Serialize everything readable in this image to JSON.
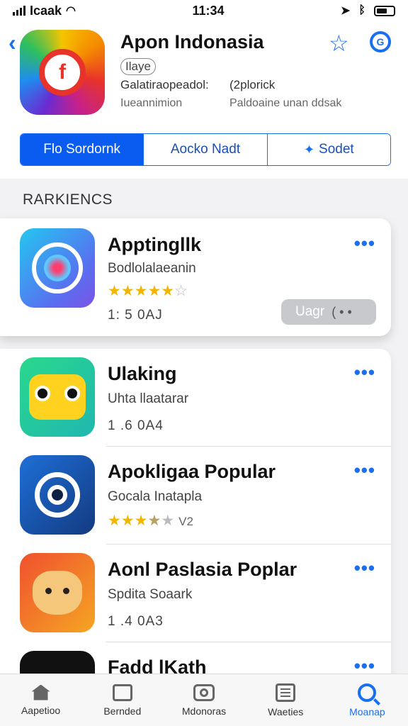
{
  "status_bar": {
    "carrier": "Icaak",
    "time": "11:34"
  },
  "header": {
    "back_icon": "chevron-left-icon",
    "title": "Apon Indonasia",
    "subtitle": "Ilaye",
    "meta_1": "Galatiraopeadol:",
    "meta_2": "(2plorick",
    "meta_3": "Iueannimion",
    "meta_4": "Paldoaine unan ddsak"
  },
  "segments": [
    {
      "label": "Flo Sordornk"
    },
    {
      "label": "Aocko Nadt"
    },
    {
      "label": "Sodet"
    }
  ],
  "section_title": "RARKIENCS",
  "featured": {
    "name": "Apptingllk",
    "sub": "Bodlolalaeanin",
    "stars": "★★★★★",
    "empty_star": "☆",
    "stat": "1: 5 0AJ",
    "get_label": "Uagr",
    "get_dots": "( • •",
    "more": "•••"
  },
  "apps": [
    {
      "name": "Ulaking",
      "sub": "Uhta llaatarar",
      "stat": "1 .6 0A4",
      "more": "•••"
    },
    {
      "name": "Apokligaa Popular",
      "sub": "Gocala Inatapla",
      "stars": "★★★",
      "half": "★",
      "empty": "★",
      "rating": "V2",
      "more": "•••"
    },
    {
      "name": "Aonl Paslasia Poplar",
      "sub": "Spdita Soaark",
      "stat": "1 .4 0A3",
      "more": "•••"
    },
    {
      "name": "Fadd lKath",
      "more": "•••"
    }
  ],
  "tabs": [
    {
      "label": "Aapetioo",
      "icon": "home-icon"
    },
    {
      "label": "Bernded",
      "icon": "box-icon"
    },
    {
      "label": "Mdonoras",
      "icon": "camera-icon"
    },
    {
      "label": "Waeties",
      "icon": "list-icon"
    },
    {
      "label": "Moanap",
      "icon": "search-icon"
    }
  ],
  "colors": {
    "accent": "#1a6ff0",
    "active_segment": "#0a5cf0",
    "star": "#f2b600"
  }
}
